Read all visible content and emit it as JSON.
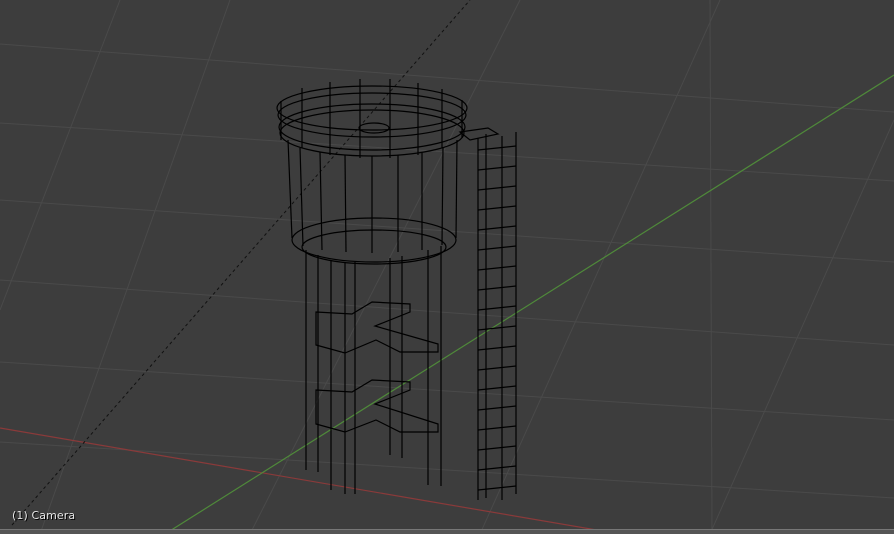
{
  "viewport": {
    "object_label": "(1) Camera",
    "background_color": "#3d3d3d",
    "grid_color": "#4a4a4a",
    "x_axis_color": "#8a3a3a",
    "y_axis_color": "#4f8a3a",
    "wire_color": "#000000"
  },
  "scene": {
    "object": "water-tower-wireframe"
  }
}
